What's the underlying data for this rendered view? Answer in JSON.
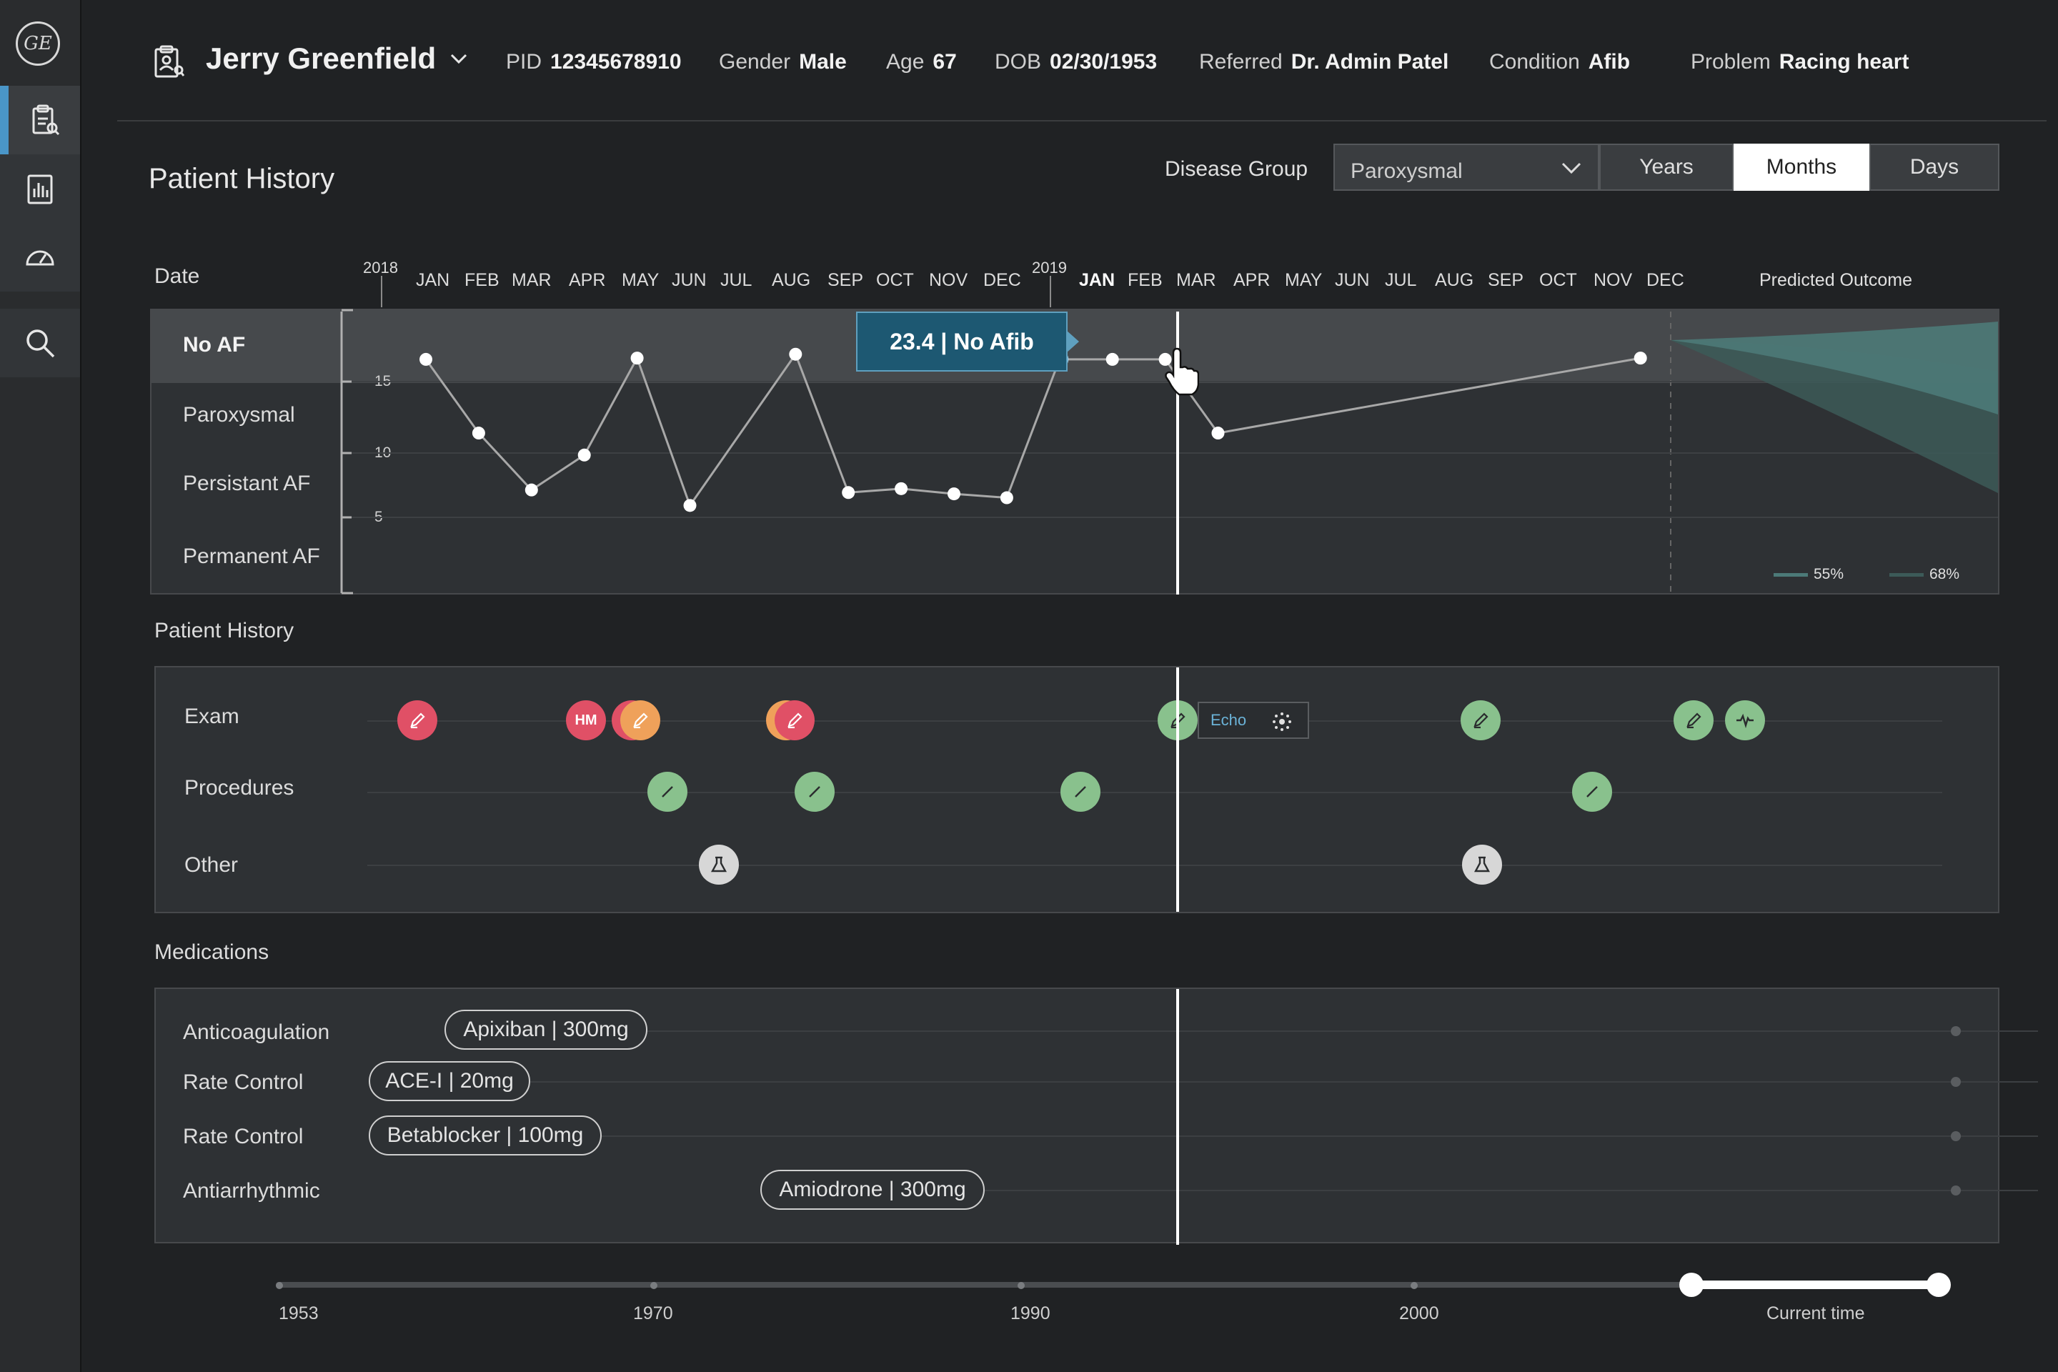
{
  "header": {
    "patient_name": "Jerry Greenfield",
    "fields": [
      {
        "label": "PID",
        "value": "12345678910"
      },
      {
        "label": "Gender",
        "value": "Male"
      },
      {
        "label": "Age",
        "value": "67"
      },
      {
        "label": "DOB",
        "value": "02/30/1953"
      },
      {
        "label": "Referred",
        "value": "Dr. Admin Patel"
      },
      {
        "label": "Condition",
        "value": "Afib"
      },
      {
        "label": "Problem",
        "value": "Racing heart"
      }
    ]
  },
  "sidebar": {
    "logo_text": "GE",
    "items": [
      {
        "name": "patient-records",
        "active": true,
        "icon": "clipboard-icon"
      },
      {
        "name": "reports",
        "active": false,
        "icon": "report-chart-icon"
      },
      {
        "name": "dashboard",
        "active": false,
        "icon": "gauge-icon"
      },
      {
        "name": "search",
        "active": false,
        "icon": "search-icon"
      }
    ]
  },
  "history": {
    "title": "Patient History",
    "disease_group_label": "Disease Group",
    "disease_group_value": "Paroxysmal",
    "scale_tabs": [
      "Years",
      "Months",
      "Days"
    ],
    "active_scale": "Months",
    "date_label": "Date",
    "years": [
      "2018",
      "2019"
    ],
    "months_2018": [
      "JAN",
      "FEB",
      "MAR",
      "APR",
      "MAY",
      "JUN",
      "JUL",
      "AUG",
      "SEP",
      "OCT",
      "NOV",
      "DEC"
    ],
    "months_2019": [
      "JAN",
      "FEB",
      "MAR",
      "APR",
      "MAY",
      "JUN",
      "JUL",
      "AUG",
      "SEP",
      "OCT",
      "NOV",
      "DEC"
    ],
    "predicted_label": "Predicted Outcome",
    "states": [
      "No AF",
      "Paroxysmal",
      "Persistant AF",
      "Permanent AF"
    ],
    "yticks": [
      "15",
      "10",
      "5"
    ],
    "tooltip": "23.4 | No Afib",
    "legend": [
      {
        "label": "55%",
        "color": "#4c7a78"
      },
      {
        "label": "68%",
        "color": "#3c5a58"
      }
    ]
  },
  "chart_data": {
    "type": "line",
    "x": [
      "2018-01",
      "2018-02",
      "2018-03",
      "2018-04",
      "2018-05",
      "2018-06",
      "2018-08",
      "2018-09",
      "2018-10",
      "2018-11",
      "2018-12",
      "2019-01",
      "2019-02",
      "2019-03",
      "2019-04",
      "2019-12"
    ],
    "y": [
      18.3,
      12.6,
      8.2,
      10.9,
      18.4,
      7.0,
      18.7,
      8.0,
      8.3,
      7.9,
      7.6,
      18.3,
      18.3,
      18.3,
      12.6,
      18.4
    ],
    "highlighted_point": {
      "x": "2019-01",
      "label": "23.4 | No Afib"
    },
    "ylim": [
      0,
      22
    ],
    "yticks": [
      5,
      10,
      15
    ],
    "prediction_bands": [
      "55%",
      "68%"
    ]
  },
  "events": {
    "title": "Patient History",
    "rows": [
      "Exam",
      "Procedures",
      "Other"
    ],
    "echo_label": "Echo"
  },
  "medications": {
    "title": "Medications",
    "rows": [
      {
        "label": "Anticoagulation",
        "pill": "Apixiban | 300mg"
      },
      {
        "label": "Rate Control",
        "pill": "ACE-I | 20mg"
      },
      {
        "label": "Rate Control",
        "pill": "Betablocker | 100mg"
      },
      {
        "label": "Antiarrhythmic",
        "pill": "Amiodrone | 300mg"
      }
    ]
  },
  "timeline": {
    "labels": [
      "1953",
      "1970",
      "1990",
      "2000",
      "Current time"
    ]
  }
}
